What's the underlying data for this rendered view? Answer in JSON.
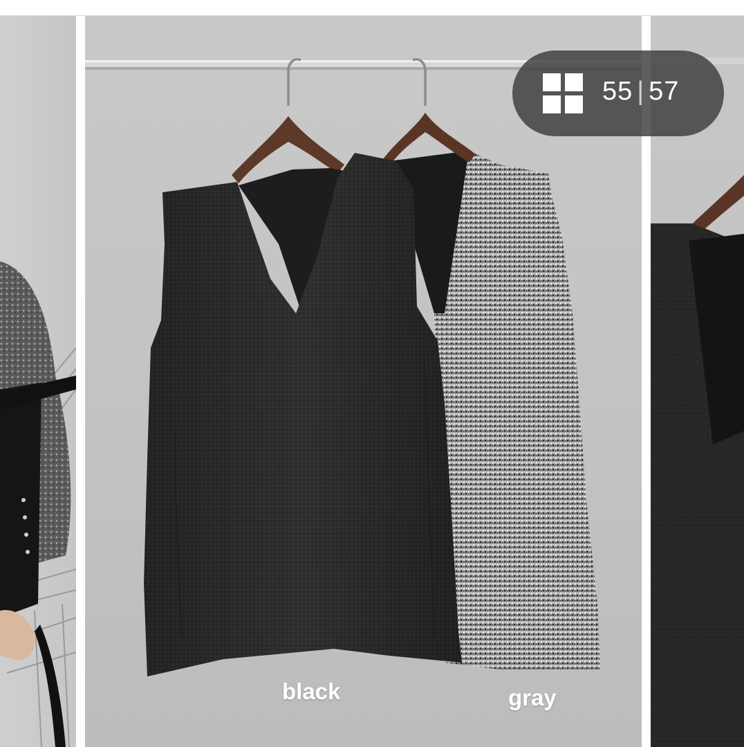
{
  "viewer": {
    "current_index": "55",
    "separator": "|",
    "total_count": "57",
    "grid_icon": "grid-icon"
  },
  "main_image": {
    "labels": {
      "black": "black",
      "gray": "gray"
    }
  },
  "colors": {
    "overlay_bg": "#3c3c3c",
    "background_gray": "#c4c4c4",
    "black_vest": "#2e2e2e",
    "gray_vest": "#8a8a8a"
  }
}
